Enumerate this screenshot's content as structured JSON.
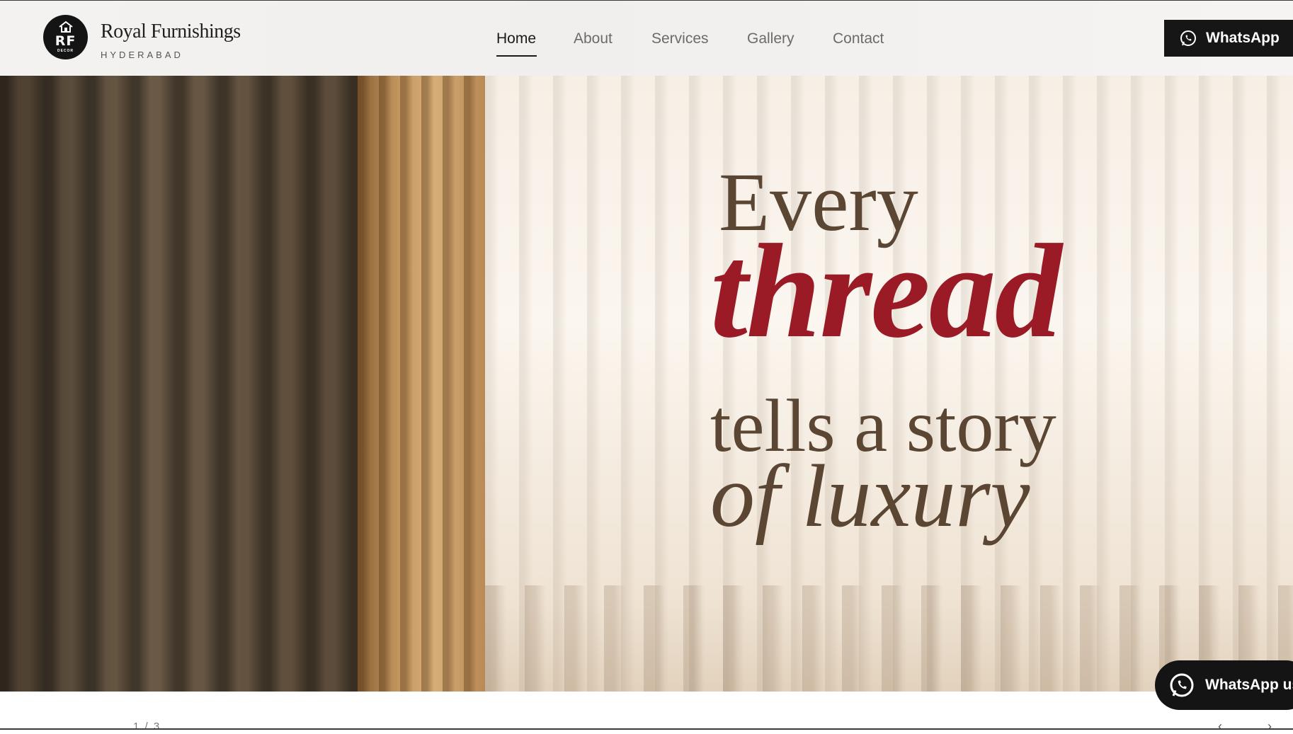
{
  "brand": {
    "logo_mono": "RF",
    "logo_sub": "DECOR",
    "name": "Royal Furnishings",
    "city": "HYDERABAD"
  },
  "nav": {
    "items": [
      {
        "label": "Home",
        "active": true
      },
      {
        "label": "About"
      },
      {
        "label": "Services"
      },
      {
        "label": "Gallery"
      },
      {
        "label": "Contact"
      }
    ]
  },
  "header_cta": {
    "label": "WhatsApp",
    "icon": "whatsapp-icon"
  },
  "hero": {
    "line1": "Every",
    "line2": "thread",
    "line3": "tells a story",
    "line4": "of luxury",
    "accent_color": "#9a1a26",
    "text_color": "#5a4632"
  },
  "float_cta": {
    "label": "WhatsApp us",
    "icon": "whatsapp-icon"
  },
  "slider": {
    "counter": "1 / 3",
    "prev": "‹",
    "next": "›"
  }
}
